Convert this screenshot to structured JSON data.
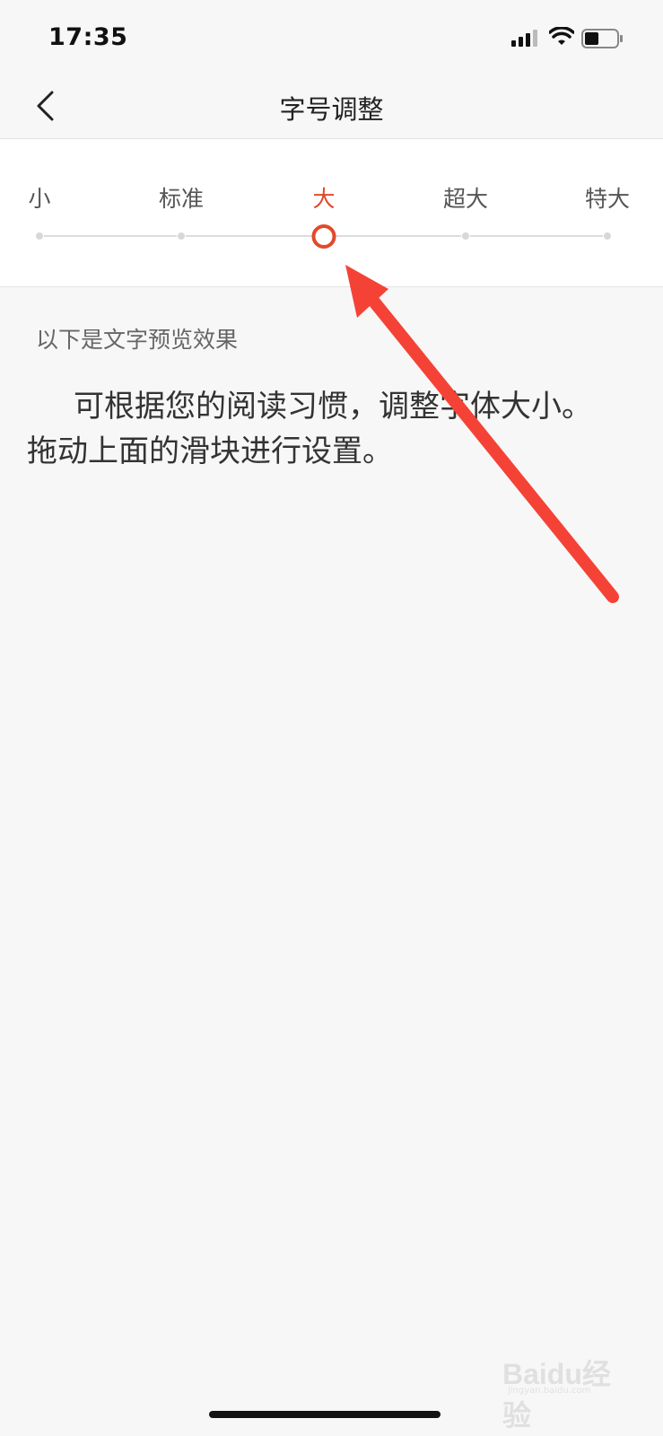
{
  "status_bar": {
    "time": "17:35"
  },
  "nav": {
    "title": "字号调整"
  },
  "font_slider": {
    "options": [
      "小",
      "标准",
      "大",
      "超大",
      "特大"
    ],
    "selected_index": 2,
    "accent_color": "#e2492b"
  },
  "preview": {
    "caption": "以下是文字预览效果",
    "text": "可根据您的阅读习惯，调整字体大小。拖动上面的滑块进行设置。"
  },
  "watermark": {
    "brand": "Baidu经验",
    "url": "jingyan.baidu.com"
  },
  "annotation": {
    "color": "#f44336"
  }
}
